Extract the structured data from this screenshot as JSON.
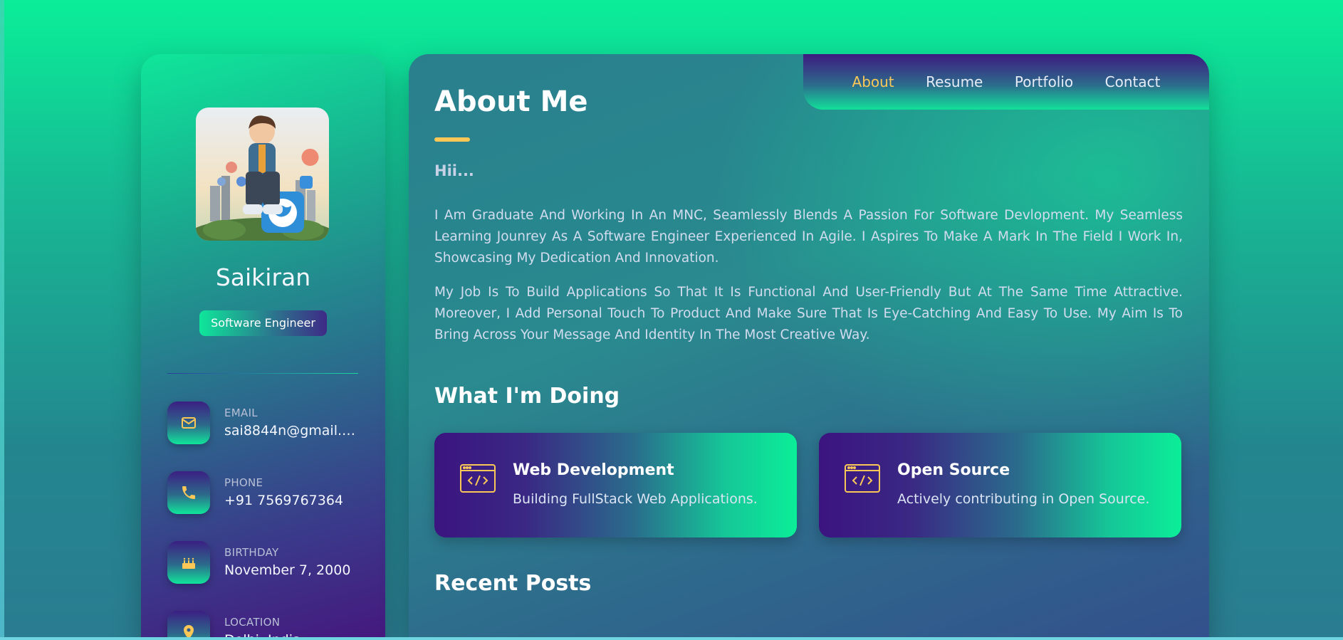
{
  "sidebar": {
    "name": "Saikiran",
    "title_badge": "Software Engineer",
    "avatar_icon": "cartoon-boy-avatar",
    "contacts": [
      {
        "label": "Email",
        "value": "sai8844n@gmail.co...",
        "icon": "mail-icon"
      },
      {
        "label": "Phone",
        "value": "+91 7569767364",
        "icon": "phone-icon"
      },
      {
        "label": "Birthday",
        "value": "November 7, 2000",
        "icon": "cake-icon"
      },
      {
        "label": "Location",
        "value": "Delhi, India",
        "icon": "location-pin-icon"
      }
    ]
  },
  "nav": {
    "links": [
      {
        "label": "About",
        "active": true
      },
      {
        "label": "Resume",
        "active": false
      },
      {
        "label": "Portfolio",
        "active": false
      },
      {
        "label": "Contact",
        "active": false
      }
    ]
  },
  "about": {
    "title": "About Me",
    "greeting": "Hii...",
    "paragraphs": [
      "I Am Graduate And Working In An MNC, Seamlessly Blends A Passion For Software Devlopment. My Seamless Learning Jounrey As A Software Engineer Experienced In Agile. I Aspires To Make A Mark In The Field I Work In, Showcasing My Dedication And Innovation.",
      "My Job Is To Build Applications So That It Is Functional And User-Friendly But At The Same Time Attractive. Moreover, I Add Personal Touch To Product And Make Sure That Is Eye-Catching And Easy To Use. My Aim Is To Bring Across Your Message And Identity In The Most Creative Way."
    ]
  },
  "services": {
    "heading": "What I'm Doing",
    "items": [
      {
        "title": "Web Development",
        "description": "Building FullStack Web Applications.",
        "icon": "code-window-icon"
      },
      {
        "title": "Open Source",
        "description": "Actively contributing in Open Source.",
        "icon": "code-window-icon"
      }
    ]
  },
  "recent_posts": {
    "heading": "Recent Posts"
  },
  "colors": {
    "accent": "#fbc858",
    "brand_green": "#0fe69a",
    "brand_purple": "#3e1b80"
  }
}
